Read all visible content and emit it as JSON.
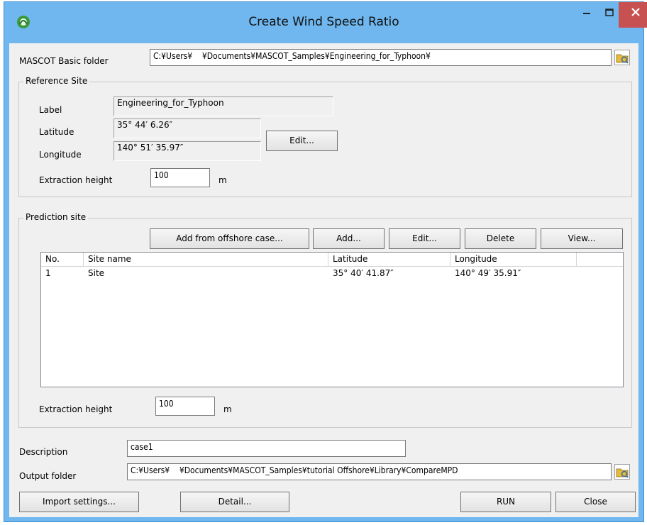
{
  "window": {
    "title": "Create Wind Speed Ratio"
  },
  "basic_folder": {
    "label": "MASCOT Basic folder",
    "value": "C:¥Users¥    ¥Documents¥MASCOT_Samples¥Engineering_for_Typhoon¥"
  },
  "reference_site": {
    "group_title": "Reference Site",
    "label_caption": "Label",
    "label_value": "Engineering_for_Typhoon",
    "latitude_caption": "Latitude",
    "latitude_value": "35°  44′  6.26″",
    "longitude_caption": "Longitude",
    "longitude_value": "140°  51′  35.97″",
    "edit_button": "Edit...",
    "extraction_caption": "Extraction height",
    "extraction_value": "100",
    "extraction_unit": "m"
  },
  "prediction_site": {
    "group_title": "Prediction site",
    "buttons": {
      "add_offshore": "Add from offshore case...",
      "add": "Add...",
      "edit": "Edit...",
      "delete": "Delete",
      "view": "View..."
    },
    "columns": [
      "No.",
      "Site name",
      "Latitude",
      "Longitude"
    ],
    "rows": [
      {
        "no": "1",
        "name": "Site",
        "latitude": "35°  40′  41.87″",
        "longitude": "140°  49′  35.91″"
      }
    ],
    "extraction_caption": "Extraction height",
    "extraction_value": "100",
    "extraction_unit": "m"
  },
  "description": {
    "label": "Description",
    "value": "case1"
  },
  "output_folder": {
    "label": "Output folder",
    "value": "C:¥Users¥    ¥Documents¥MASCOT_Samples¥tutorial Offshore¥Library¥CompareMPD"
  },
  "footer": {
    "import_settings": "Import settings...",
    "detail": "Detail...",
    "run": "RUN",
    "close": "Close"
  },
  "colors": {
    "titlebar": "#6fb7ee",
    "close_button": "#c75050",
    "client_bg": "#f0f0f0"
  },
  "icons": [
    "app-icon",
    "minimize-icon",
    "maximize-icon",
    "close-icon",
    "folder-browse-icon"
  ]
}
